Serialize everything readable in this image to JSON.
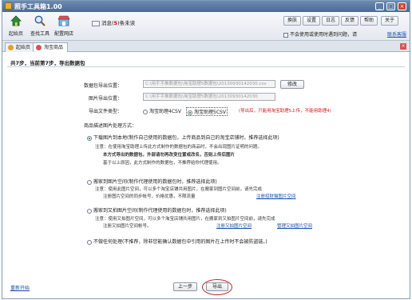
{
  "window": {
    "title": "照手工具箱1.00",
    "minimize": "_",
    "restore": "□",
    "close": "×"
  },
  "toolbar": {
    "tools": [
      {
        "label": "起始页"
      },
      {
        "label": "查找工具"
      },
      {
        "label": "配置网店"
      }
    ],
    "message_prefix": "消息(",
    "message_count": "5",
    "message_suffix": ")条未读",
    "buttons": [
      "换肤",
      "设置",
      "日志",
      "反馈",
      "帮助",
      "关于"
    ],
    "hide_unused": "不会使用或使用时遇到问题，请",
    "contact_link": "联系客服"
  },
  "tabs": [
    "起始页",
    "淘宝商品"
  ],
  "step_text": "共7步，当前第7步，导出数据包",
  "form": {
    "package_label": "数据包导出位置：",
    "package_path": "C:\\用手手推数据包\\淘宝助理5数据包\\20130930142030.csv",
    "modify_button": "修改",
    "image_label": "图片导出位置：",
    "image_path": "C:\\用手手推数据包\\淘宝助理5数据包\\20130930142030",
    "filetype_label": "导出文件类型：",
    "filetype_options": [
      "淘宝助理4CSV",
      "淘宝助理5CSV"
    ],
    "filetype_note": "(导出后，只能用淘宝助理5上传，不能用助理4)",
    "image_section_label": "商品描述图片处理方式："
  },
  "options": [
    {
      "title": "下载图片到本地(制作自己使用的数据包，上传商品到自己的淘宝店铺时，推荐选择此项)",
      "lines": [
        "注意：在使用淘宝助理上传此方式制作的数据包的商品时，不会出现图片证明的问题。",
        "本方式导出的数据包，外部请勿再改变位置或改名，否则上传后图片",
        "基于以上原因，此方式制作的数据包，不推荐给你代理使用。"
      ],
      "selected": true
    },
    {
      "title": "搬家到图片空间(制作代理使用的数据包时，推荐选择此项)",
      "lines": [
        "注意：使用此图片空间，可以多个淘宝店铺共用图片，在搬家到图片空间前，请先完成",
        "注册图片空间的同步帐号，价格优惠，不限流量"
      ],
      "link": "注册招财猫图片空间",
      "selected": false
    },
    {
      "title": "搬家到又拍图片空间(制作代理使用的数据包时，推荐选择此项)",
      "lines": [
        "注意：使用又拍图片空间，可以多个淘宝店铺共用图片，在搬家到又拍图片空间前，请先完成",
        "注册又拍图片空间帐号。"
      ],
      "links": [
        "注册又拍图片空间",
        "管理又拍图片空间"
      ],
      "selected": false
    },
    {
      "title": "不做任何处理(不推荐，除非您能确认数据包中引用的图片在上传时不会被防盗链。)",
      "selected": false
    }
  ],
  "footer": {
    "restart": "重新开始",
    "prev": "上一步",
    "export": "导出"
  }
}
